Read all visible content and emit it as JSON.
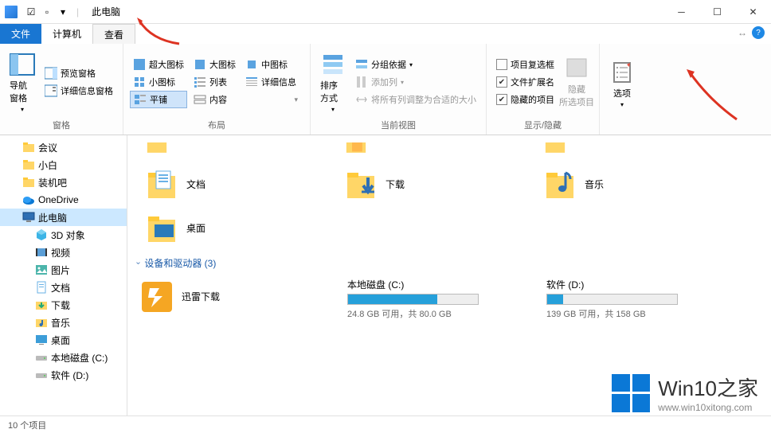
{
  "window": {
    "title": "此电脑"
  },
  "tabs": {
    "file": "文件",
    "computer": "计算机",
    "view": "查看"
  },
  "ribbon": {
    "panes": {
      "nav_pane": "导航窗格",
      "preview_pane": "预览窗格",
      "detail_pane": "详细信息窗格",
      "group_label": "窗格"
    },
    "layout": {
      "xl_icon": "超大图标",
      "l_icon": "大图标",
      "m_icon": "中图标",
      "s_icon": "小图标",
      "list": "列表",
      "details": "详细信息",
      "tiles": "平铺",
      "content": "内容",
      "group_label": "布局"
    },
    "view": {
      "sort": "排序方式",
      "group_by": "分组依据",
      "add_col": "添加列",
      "size_all": "将所有列调整为合适的大小",
      "group_label": "当前视图"
    },
    "showhide": {
      "item_check": "项目复选框",
      "ext": "文件扩展名",
      "hidden": "隐藏的项目",
      "hide_selected": "隐藏\n所选项目",
      "group_label": "显示/隐藏"
    },
    "options": "选项"
  },
  "sidebar": {
    "items": [
      {
        "label": "会议",
        "type": "folder"
      },
      {
        "label": "小白",
        "type": "folder"
      },
      {
        "label": "装机吧",
        "type": "folder"
      },
      {
        "label": "OneDrive",
        "type": "onedrive"
      },
      {
        "label": "此电脑",
        "type": "pc",
        "selected": true
      },
      {
        "label": "3D 对象",
        "type": "3d",
        "indent": true
      },
      {
        "label": "视频",
        "type": "video",
        "indent": true
      },
      {
        "label": "图片",
        "type": "picture",
        "indent": true
      },
      {
        "label": "文档",
        "type": "doc",
        "indent": true
      },
      {
        "label": "下载",
        "type": "download",
        "indent": true
      },
      {
        "label": "音乐",
        "type": "music",
        "indent": true
      },
      {
        "label": "桌面",
        "type": "desktop",
        "indent": true
      },
      {
        "label": "本地磁盘 (C:)",
        "type": "drive",
        "indent": true
      },
      {
        "label": "软件 (D:)",
        "type": "drive",
        "indent": true
      }
    ]
  },
  "content": {
    "folders": [
      {
        "label": "文档",
        "icon": "doc"
      },
      {
        "label": "下载",
        "icon": "download"
      },
      {
        "label": "音乐",
        "icon": "music"
      },
      {
        "label": "桌面",
        "icon": "desktop"
      }
    ],
    "section_devices": "设备和驱动器 (3)",
    "devices": [
      {
        "label": "迅雷下载",
        "icon": "xunlei"
      }
    ],
    "drives": [
      {
        "label": "本地磁盘 (C:)",
        "free": "24.8 GB 可用，共 80.0 GB",
        "pct": 69
      },
      {
        "label": "软件 (D:)",
        "free": "139 GB 可用，共 158 GB",
        "pct": 12
      }
    ]
  },
  "status": {
    "count": "10 个项目"
  },
  "watermark": {
    "main": "Win10之家",
    "sub": "www.win10xitong.com"
  }
}
